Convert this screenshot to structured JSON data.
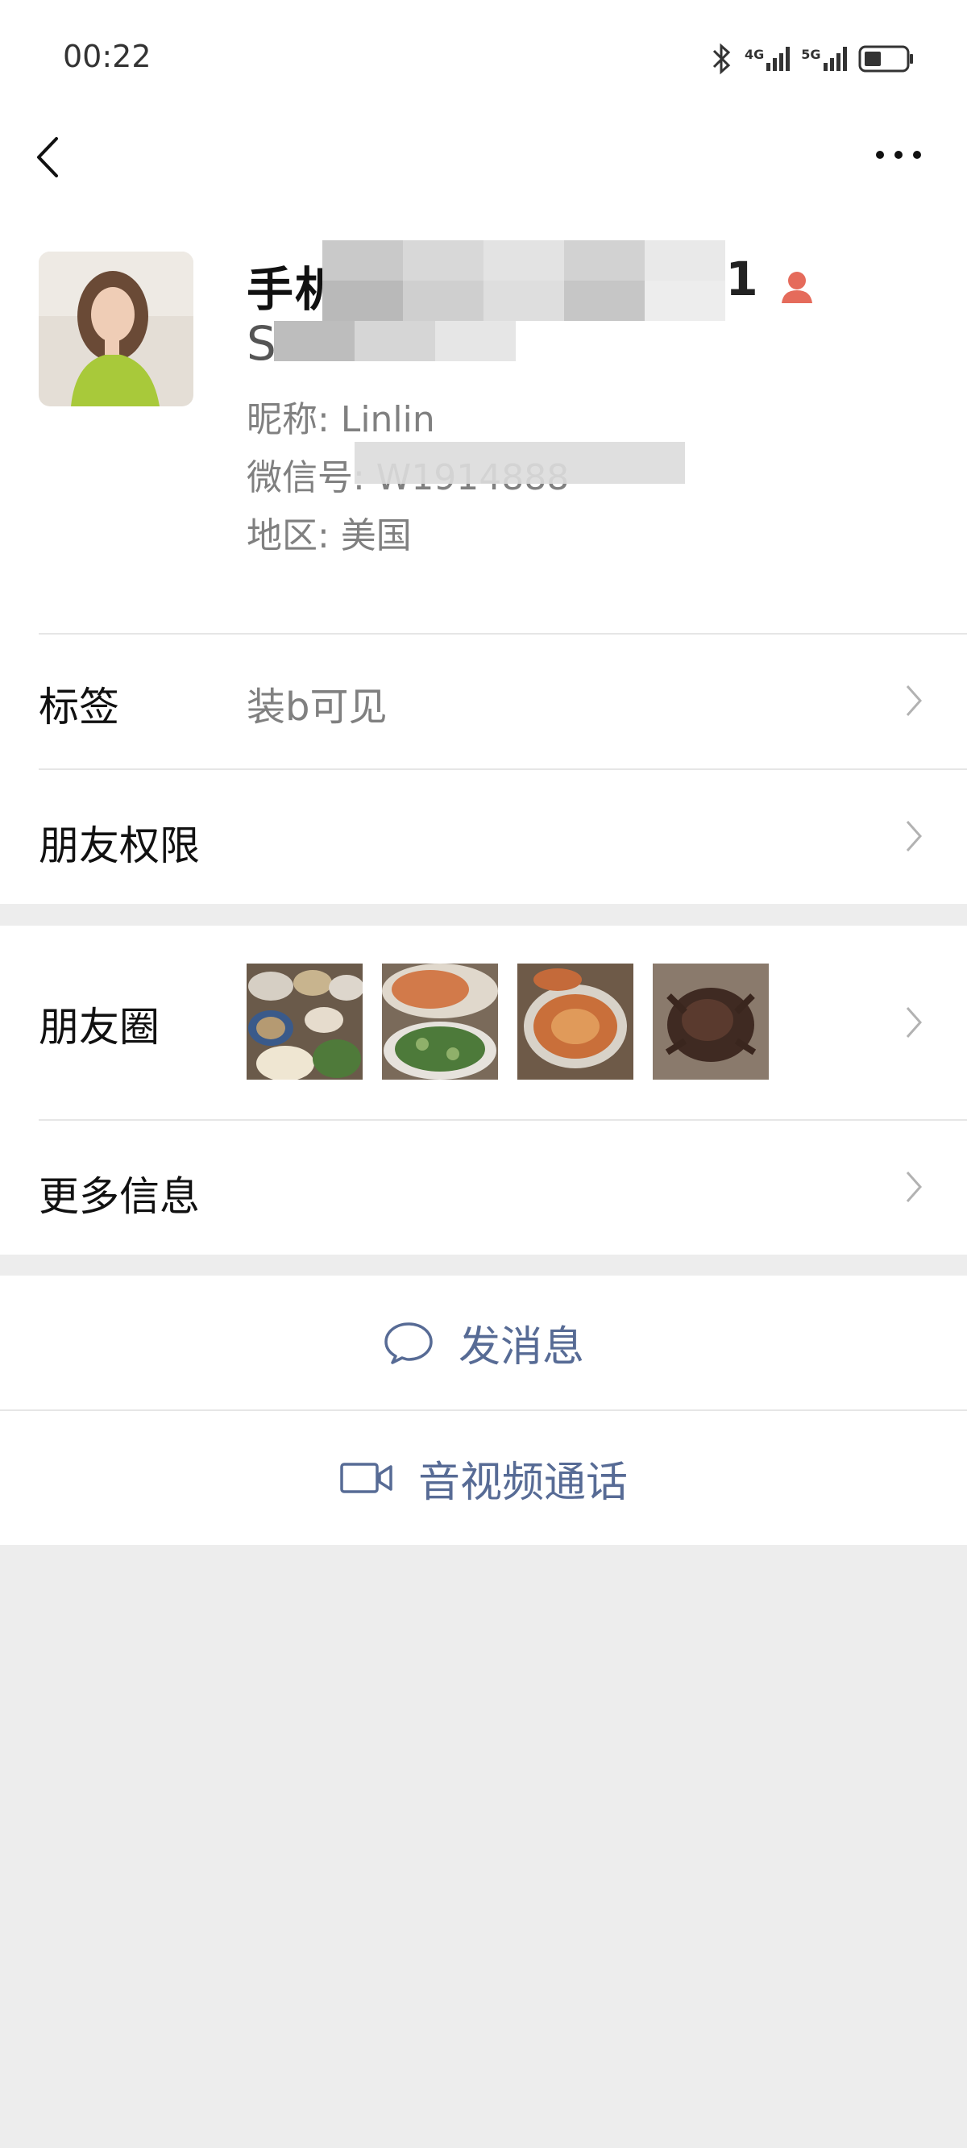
{
  "status_bar": {
    "time": "00:22",
    "bluetooth_icon": "bluetooth-icon",
    "signal1_label": "4G",
    "signal2_label": "5G",
    "battery_icon": "battery-icon"
  },
  "nav": {
    "back_icon": "chevron-left-icon",
    "more_icon": "more-dots-icon"
  },
  "profile": {
    "name_line1": "手机",
    "name_tail": "61",
    "name_line2": "Sa",
    "nickname": "昵称: Linlin",
    "wechat_id": "微信号: W1914888",
    "region": "地区: 美国",
    "gender_icon": "female-icon",
    "avatar_icon": "avatar-photo"
  },
  "cells": {
    "tags_label": "标签",
    "tags_value": "装b可见",
    "permissions_label": "朋友权限",
    "moments_label": "朋友圈",
    "more_info_label": "更多信息"
  },
  "actions": {
    "message_label": "发消息",
    "message_icon": "chat-bubble-icon",
    "call_label": "音视频通话",
    "call_icon": "video-camera-icon"
  },
  "colors": {
    "link": "#576b95",
    "background": "#ededed",
    "gender_icon": "#e56b5b"
  }
}
